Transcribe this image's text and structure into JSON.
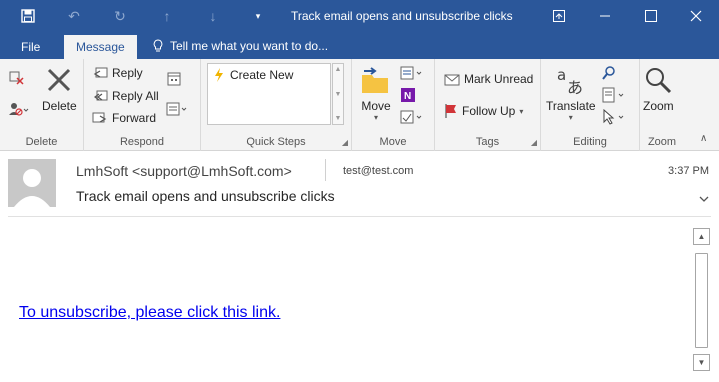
{
  "titlebar": {
    "title": "Track email opens and unsubscribe clicks",
    "icons": [
      "save-icon",
      "undo-icon",
      "redo-icon",
      "up-arrow-icon",
      "down-arrow-icon",
      "customize-icon",
      "restore-icon",
      "minimize-icon",
      "maximize-icon",
      "close-icon"
    ]
  },
  "tabs": [
    {
      "label": "File"
    },
    {
      "label": "Message"
    }
  ],
  "tell_me": {
    "placeholder": "Tell me what you want to do..."
  },
  "ribbon": {
    "delete_group": {
      "label": "Delete",
      "delete_button": "Delete"
    },
    "respond_group": {
      "label": "Respond",
      "reply": "Reply",
      "reply_all": "Reply All",
      "forward": "Forward"
    },
    "quick_steps_group": {
      "label": "Quick Steps",
      "create_new": "Create New"
    },
    "move_group": {
      "label": "Move",
      "move_button": "Move"
    },
    "tags_group": {
      "label": "Tags",
      "mark_unread": "Mark Unread",
      "follow_up": "Follow Up"
    },
    "editing_group": {
      "label": "Editing",
      "translate": "Translate"
    },
    "zoom_group": {
      "label": "Zoom",
      "zoom_button": "Zoom"
    }
  },
  "message": {
    "sender": "LmhSoft <support@LmhSoft.com>",
    "to": "test@test.com",
    "time": "3:37 PM",
    "subject": "Track email opens and unsubscribe clicks",
    "body_link": "To unsubscribe, please click this link."
  },
  "colors": {
    "titlebar": "#2b579a",
    "ribbon_bg": "#f3f3f3",
    "link": "#0000ee"
  }
}
